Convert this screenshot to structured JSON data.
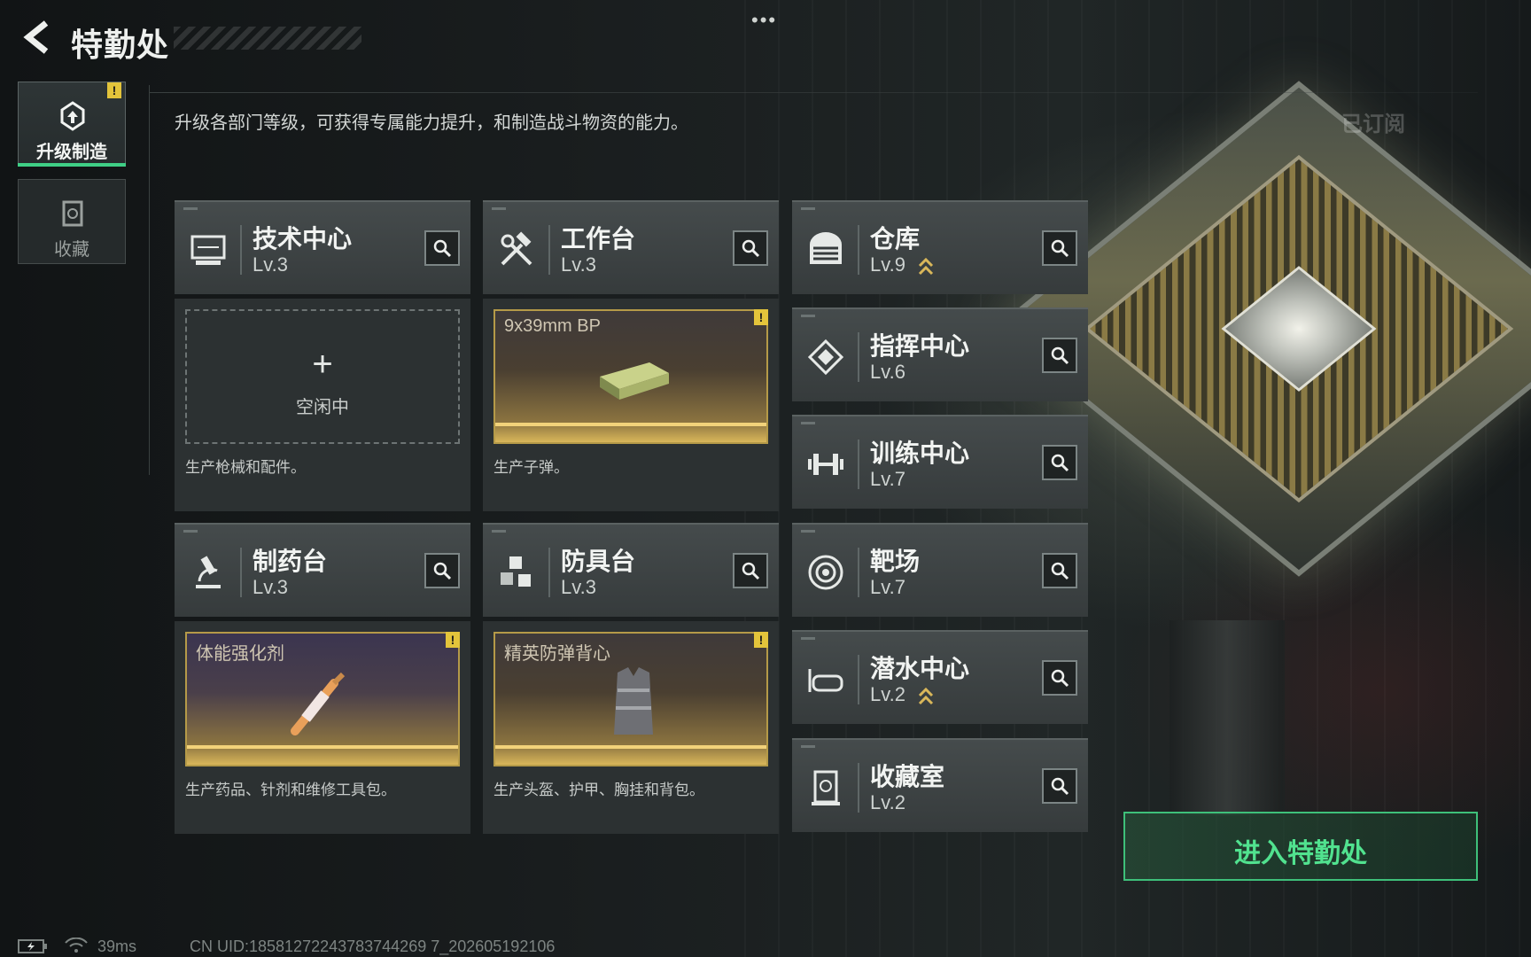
{
  "header": {
    "title": "特勤处"
  },
  "nav": [
    {
      "label": "升级制造",
      "badge": "!"
    },
    {
      "label": "收藏"
    }
  ],
  "description": "升级各部门等级，可获得专属能力提升，和制造战斗物资的能力。",
  "subscribed": "已订阅",
  "production_cards": [
    {
      "name": "技术中心",
      "level": "Lv.3",
      "slot_plus": "+",
      "slot_state": "空闲中",
      "desc": "生产枪械和配件。"
    },
    {
      "name": "工作台",
      "level": "Lv.3",
      "product": "9x39mm BP",
      "badge": "!",
      "desc": "生产子弹。"
    },
    {
      "name": "制药台",
      "level": "Lv.3",
      "product": "体能强化剂",
      "badge": "!",
      "desc": "生产药品、针剂和维修工具包。"
    },
    {
      "name": "防具台",
      "level": "Lv.3",
      "product": "精英防弹背心",
      "badge": "!",
      "desc": "生产头盔、护甲、胸挂和背包。"
    }
  ],
  "facilities": [
    {
      "name": "仓库",
      "level": "Lv.9",
      "upgradable": true
    },
    {
      "name": "指挥中心",
      "level": "Lv.6",
      "upgradable": false
    },
    {
      "name": "训练中心",
      "level": "Lv.7",
      "upgradable": false
    },
    {
      "name": "靶场",
      "level": "Lv.7",
      "upgradable": false
    },
    {
      "name": "潜水中心",
      "level": "Lv.2",
      "upgradable": true
    },
    {
      "name": "收藏室",
      "level": "Lv.2",
      "upgradable": false
    }
  ],
  "enter_button": "进入特勤处",
  "footer": {
    "ping": "39ms",
    "uid": "CN UID:18581272243783744269 7_202605192106"
  },
  "colors": {
    "accent_green": "#51e28f",
    "gold": "#d9b75a",
    "warning": "#e3c43b"
  }
}
